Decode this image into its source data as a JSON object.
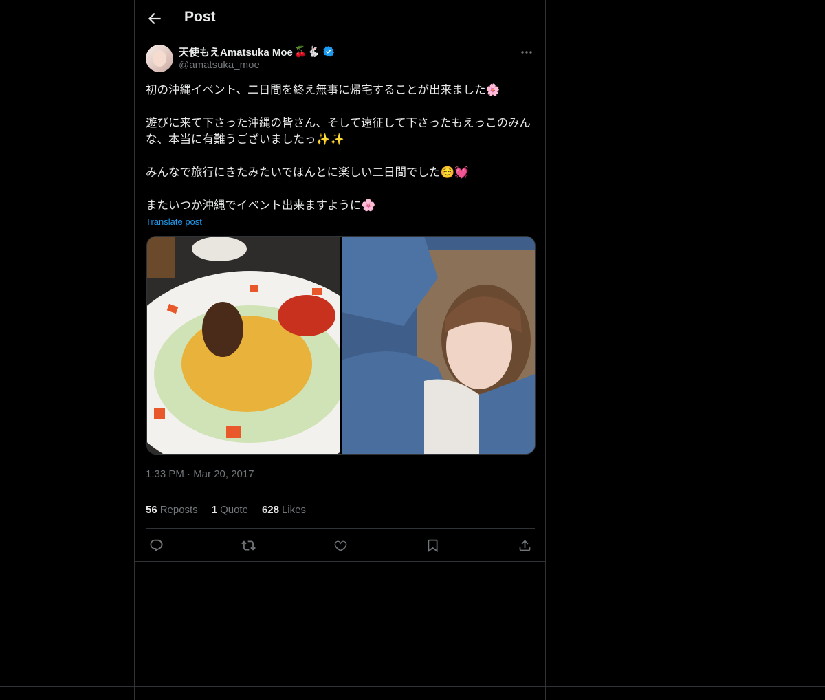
{
  "header": {
    "title": "Post"
  },
  "author": {
    "name": "天使もえAmatsuka Moe",
    "name_emojis": "🍒🐇",
    "handle": "@amatsuka_moe"
  },
  "tweet": {
    "text": "初の沖縄イベント、二日間を終え無事に帰宅することが出来ました🌸\n\n遊びに来て下さった沖縄の皆さん、そして遠征して下さったもえっこのみんな、本当に有難うございましたっ✨✨\n\nみんなで旅行にきたみたいでほんとに楽しい二日間でした☺️💓\n\nまたいつか沖縄でイベント出来ますように🌸",
    "translate_label": "Translate post",
    "timestamp": "1:33 PM · Mar 20, 2017"
  },
  "stats": {
    "reposts_count": "56",
    "reposts_label": "Reposts",
    "quotes_count": "1",
    "quotes_label": "Quote",
    "likes_count": "628",
    "likes_label": "Likes"
  },
  "colors": {
    "accent": "#1d9bf0",
    "muted": "#71767b",
    "border": "#2f3336",
    "text": "#e7e9ea"
  },
  "icons": [
    "back-arrow-icon",
    "verified-icon",
    "more-icon",
    "reply-icon",
    "repost-icon",
    "like-icon",
    "bookmark-icon",
    "share-icon"
  ]
}
